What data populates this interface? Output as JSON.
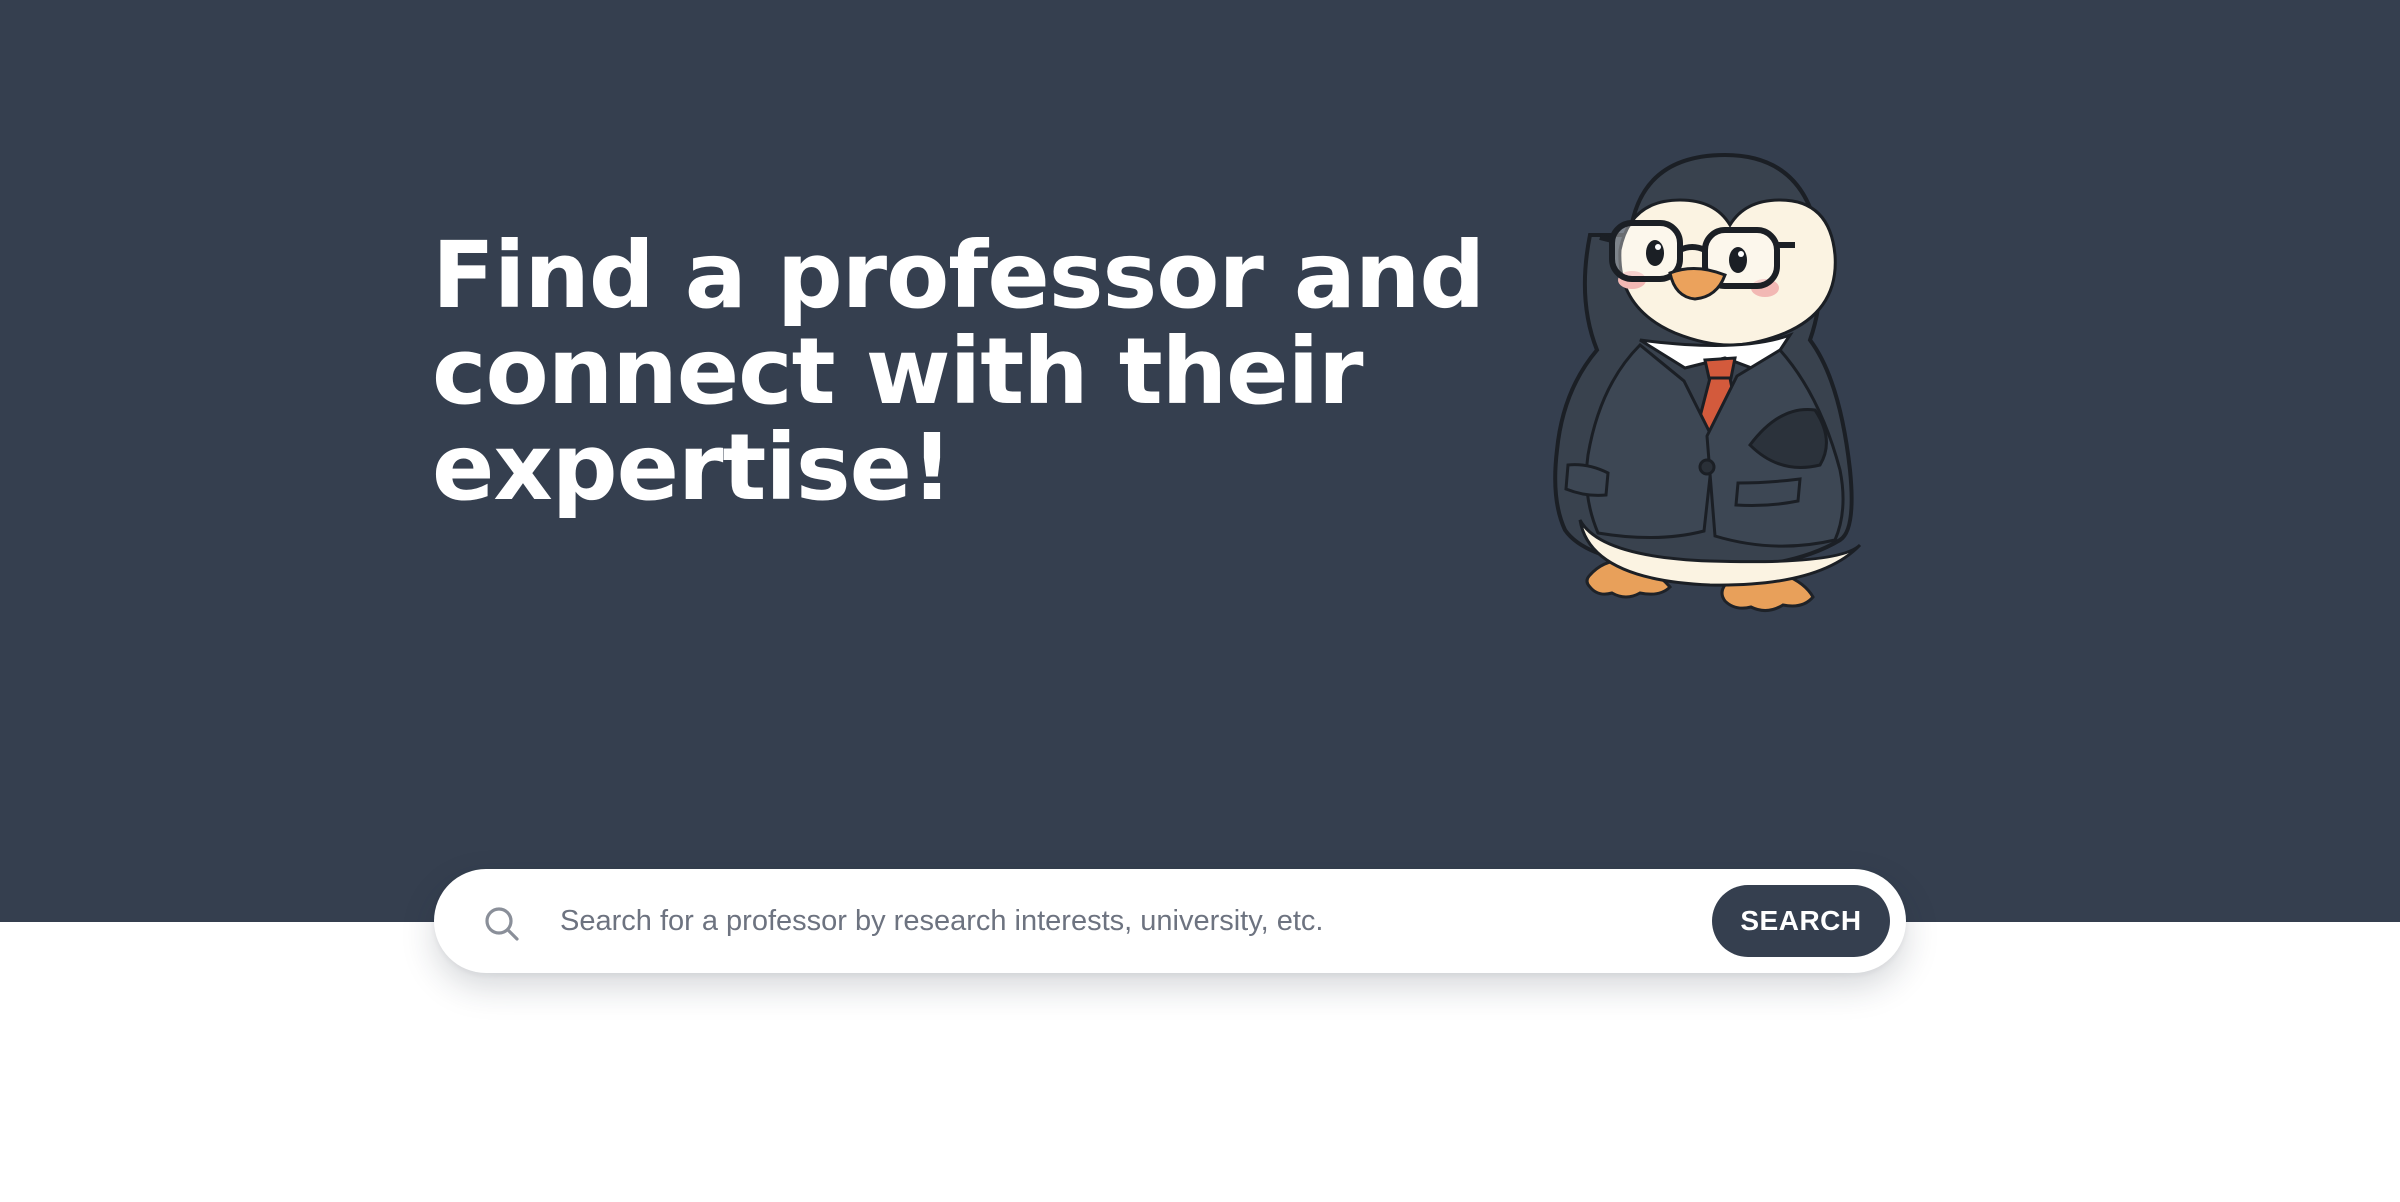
{
  "hero": {
    "headline": "Find a professor and connect with their expertise!",
    "background_color": "#353f4f",
    "mascot": {
      "icon": "penguin-professor-mascot",
      "description_icon_names": [
        "glasses-icon",
        "necktie-icon",
        "suit-jacket-icon"
      ]
    }
  },
  "search": {
    "placeholder": "Search for a professor by research interests, university, etc.",
    "value": "",
    "button_label": "SEARCH",
    "icon": "search-icon",
    "button_color": "#353f4f"
  }
}
